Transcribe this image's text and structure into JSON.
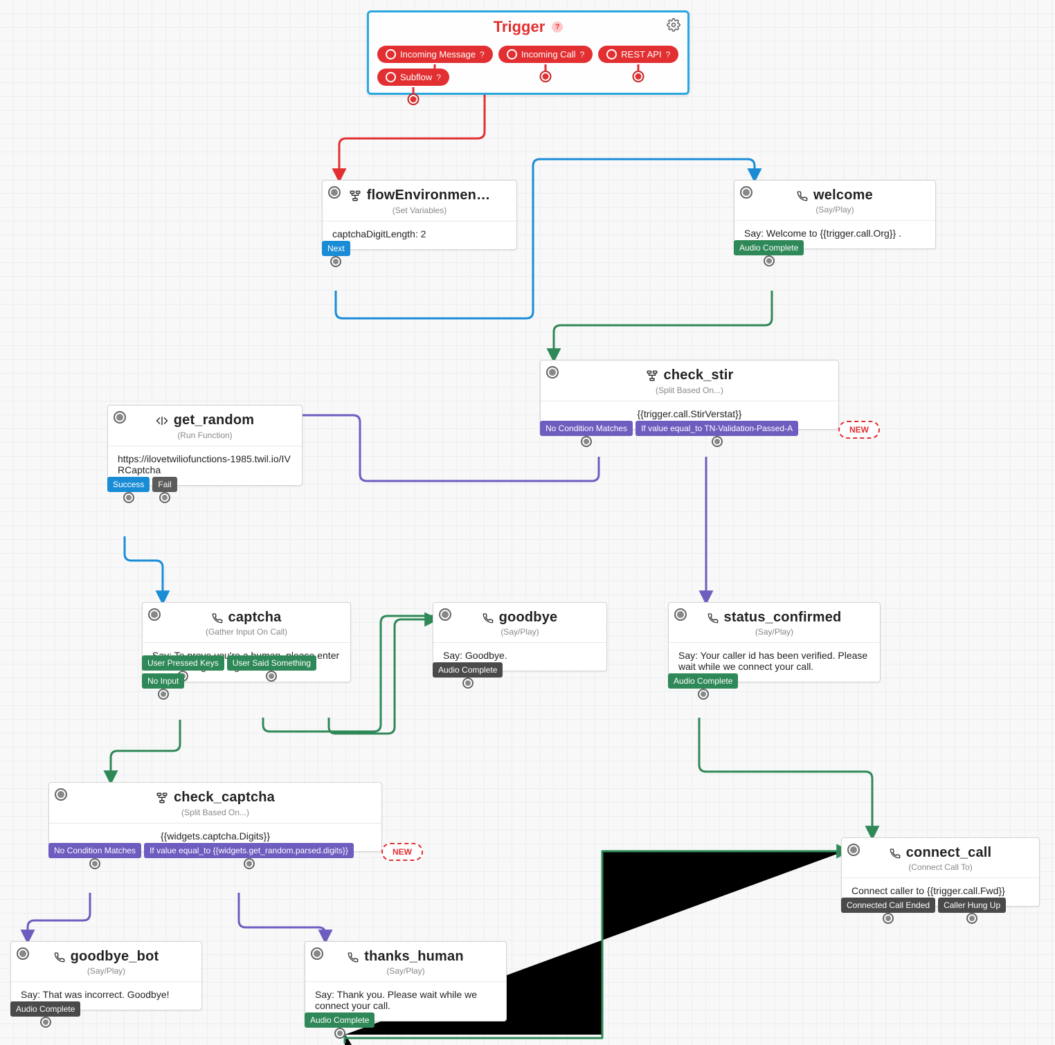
{
  "trigger": {
    "title": "Trigger",
    "pills": [
      "Incoming Message",
      "Incoming Call",
      "REST API",
      "Subflow"
    ]
  },
  "nodes": {
    "flowEnv": {
      "title": "flowEnvironmen…",
      "subtitle": "(Set Variables)",
      "body": "captchaDigitLength: 2",
      "outputs": [
        {
          "label": "Next",
          "cls": "blue"
        }
      ]
    },
    "welcome": {
      "title": "welcome",
      "subtitle": "(Say/Play)",
      "body": "Say: Welcome to {{trigger.call.Org}} .",
      "outputs": [
        {
          "label": "Audio Complete",
          "cls": "green"
        }
      ]
    },
    "check_stir": {
      "title": "check_stir",
      "subtitle": "(Split Based On...)",
      "body": "{{trigger.call.StirVerstat}}",
      "outputs": [
        {
          "label": "No Condition Matches",
          "cls": "purple"
        },
        {
          "label": "If value equal_to TN-Validation-Passed-A",
          "cls": "purple"
        }
      ],
      "new": "NEW"
    },
    "get_random": {
      "title": "get_random",
      "subtitle": "(Run Function)",
      "body": "https://ilovetwiliofunctions-1985.twil.io/IVRCaptcha",
      "outputs": [
        {
          "label": "Success",
          "cls": "blue"
        },
        {
          "label": "Fail",
          "cls": "slate"
        }
      ]
    },
    "captcha": {
      "title": "captcha",
      "subtitle": "(Gather Input On Call)",
      "body": "Say: To prove you're a human, please enter the following two digits before",
      "outputs": [
        {
          "label": "User Pressed Keys",
          "cls": "green"
        },
        {
          "label": "User Said Something",
          "cls": "green"
        },
        {
          "label": "No Input",
          "cls": "green"
        }
      ]
    },
    "goodbye": {
      "title": "goodbye",
      "subtitle": "(Say/Play)",
      "body": "Say: Goodbye.",
      "outputs": [
        {
          "label": "Audio Complete",
          "cls": "dark"
        }
      ]
    },
    "status_confirmed": {
      "title": "status_confirmed",
      "subtitle": "(Say/Play)",
      "body": "Say: Your caller id has been verified. Please wait while we connect your call.",
      "outputs": [
        {
          "label": "Audio Complete",
          "cls": "green"
        }
      ]
    },
    "check_captcha": {
      "title": "check_captcha",
      "subtitle": "(Split Based On...)",
      "body": "{{widgets.captcha.Digits}}",
      "outputs": [
        {
          "label": "No Condition Matches",
          "cls": "purple"
        },
        {
          "label": "If value equal_to {{widgets.get_random.parsed.digits}}",
          "cls": "purple"
        }
      ],
      "new": "NEW"
    },
    "goodbye_bot": {
      "title": "goodbye_bot",
      "subtitle": "(Say/Play)",
      "body": "Say: That was incorrect. Goodbye!",
      "outputs": [
        {
          "label": "Audio Complete",
          "cls": "dark"
        }
      ]
    },
    "thanks_human": {
      "title": "thanks_human",
      "subtitle": "(Say/Play)",
      "body": "Say: Thank you. Please wait while we connect your call.",
      "outputs": [
        {
          "label": "Audio Complete",
          "cls": "green"
        }
      ]
    },
    "connect_call": {
      "title": "connect_call",
      "subtitle": "(Connect Call To)",
      "body": "Connect caller to {{trigger.call.Fwd}}",
      "outputs": [
        {
          "label": "Connected Call Ended",
          "cls": "dark"
        },
        {
          "label": "Caller Hung Up",
          "cls": "dark"
        }
      ]
    }
  }
}
